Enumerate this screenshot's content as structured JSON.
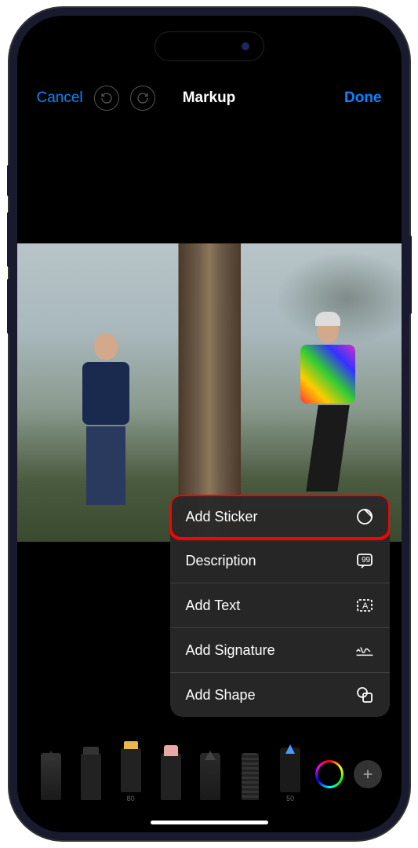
{
  "nav": {
    "cancel": "Cancel",
    "title": "Markup",
    "done": "Done"
  },
  "menu": {
    "items": [
      {
        "label": "Add Sticker",
        "icon": "sticker",
        "highlighted": true
      },
      {
        "label": "Description",
        "icon": "description",
        "highlighted": false
      },
      {
        "label": "Add Text",
        "icon": "text",
        "highlighted": false
      },
      {
        "label": "Add Signature",
        "icon": "signature",
        "highlighted": false
      },
      {
        "label": "Add Shape",
        "icon": "shape",
        "highlighted": false
      }
    ]
  },
  "toolbar": {
    "tools": [
      {
        "name": "pen",
        "label": ""
      },
      {
        "name": "marker",
        "label": ""
      },
      {
        "name": "highlighter",
        "label": "80"
      },
      {
        "name": "eraser",
        "label": ""
      },
      {
        "name": "pencil",
        "label": ""
      },
      {
        "name": "ruler",
        "label": ""
      },
      {
        "name": "blue-pen",
        "label": "50"
      }
    ]
  }
}
